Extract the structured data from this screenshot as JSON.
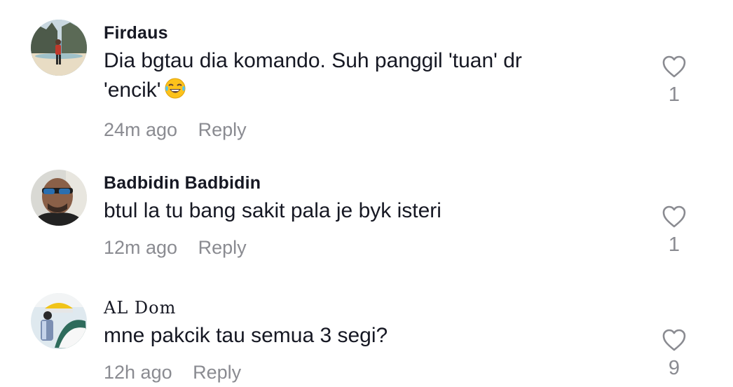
{
  "comments": [
    {
      "username": "Firdaus",
      "text": "Dia bgtau dia komando. Suh panggil 'tuan' dr 'encik'",
      "emoji": "face-with-tears-of-joy",
      "time": "24m ago",
      "reply_label": "Reply",
      "likes": "1",
      "avatar": "beach-photo"
    },
    {
      "username": "Badbidin Badbidin",
      "text": "btul la tu bang sakit pala je byk isteri",
      "time": "12m ago",
      "reply_label": "Reply",
      "likes": "1",
      "avatar": "man-sunglasses-photo"
    },
    {
      "username": "AL Dom",
      "text": "mne pakcik tau semua 3 segi?",
      "time": "12h ago",
      "reply_label": "Reply",
      "likes": "9",
      "avatar": "mosque-photo"
    }
  ],
  "colors": {
    "primary_text": "#161823",
    "secondary_text": "#8a8b91",
    "background": "#ffffff"
  },
  "icons": {
    "like": "heart-outline-icon"
  }
}
